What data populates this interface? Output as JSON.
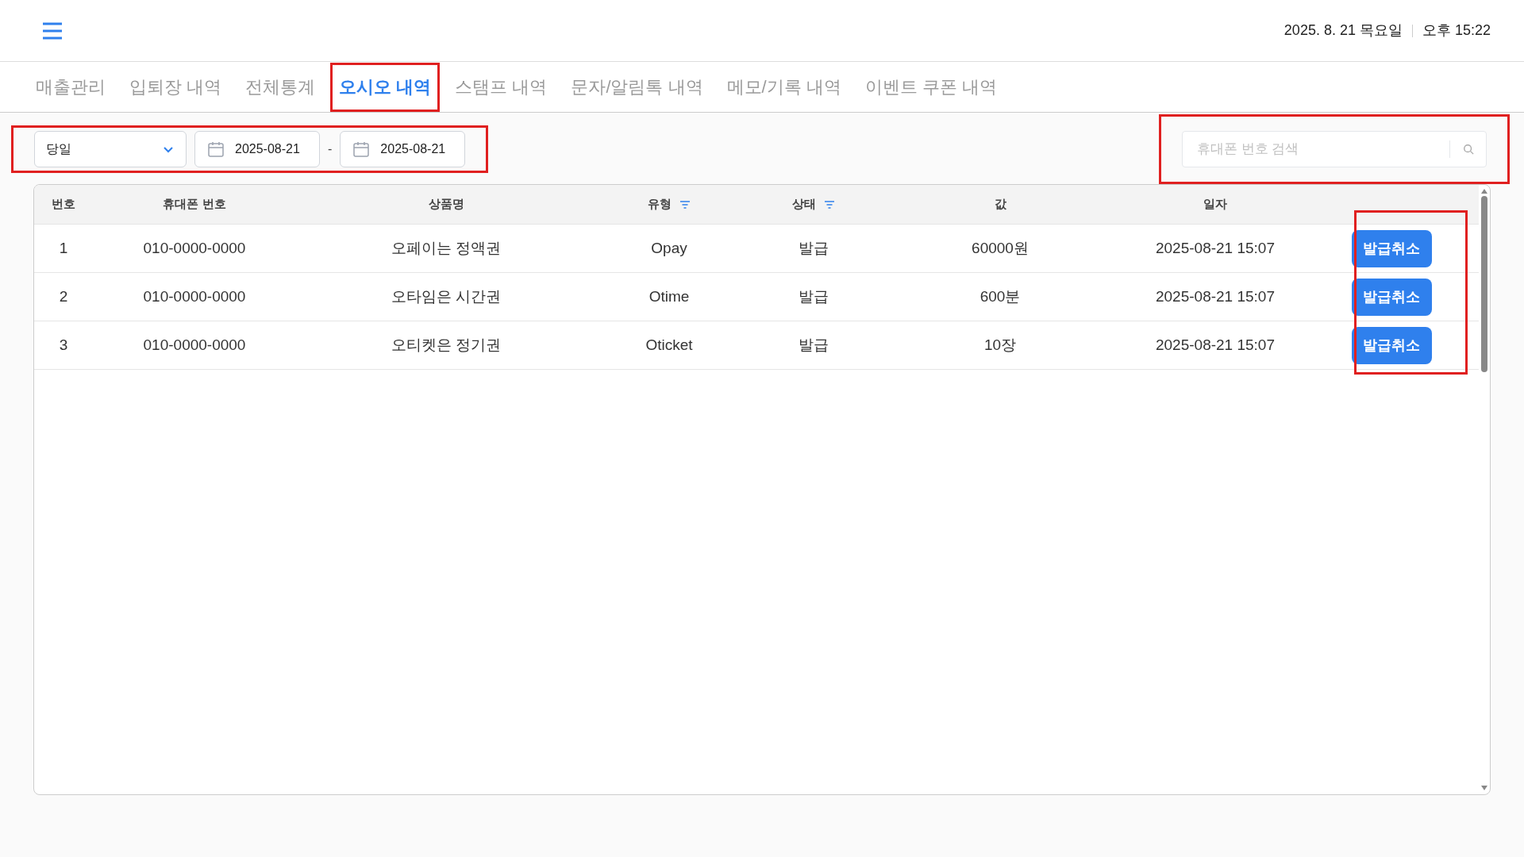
{
  "header": {
    "date": "2025. 8. 21 목요일",
    "time": "오후 15:22"
  },
  "tabs": [
    {
      "label": "매출관리",
      "selected": false,
      "highlighted": false
    },
    {
      "label": "입퇴장 내역",
      "selected": false,
      "highlighted": false
    },
    {
      "label": "전체통계",
      "selected": false,
      "highlighted": false
    },
    {
      "label": "오시오 내역",
      "selected": true,
      "highlighted": true
    },
    {
      "label": "스탬프 내역",
      "selected": false,
      "highlighted": false
    },
    {
      "label": "문자/알림톡 내역",
      "selected": false,
      "highlighted": false
    },
    {
      "label": "메모/기록 내역",
      "selected": false,
      "highlighted": false
    },
    {
      "label": "이벤트 쿠폰 내역",
      "selected": false,
      "highlighted": false
    }
  ],
  "filters": {
    "highlighted": true,
    "period": "당일",
    "start_date": "2025-08-21",
    "separator": "-",
    "end_date": "2025-08-21"
  },
  "search": {
    "highlighted": true,
    "placeholder": "휴대폰 번호 검색"
  },
  "table": {
    "actions_highlighted": true,
    "columns": [
      {
        "label": "번호",
        "filter": false
      },
      {
        "label": "휴대폰 번호",
        "filter": false
      },
      {
        "label": "상품명",
        "filter": false
      },
      {
        "label": "유형",
        "filter": true
      },
      {
        "label": "상태",
        "filter": true
      },
      {
        "label": "값",
        "filter": false
      },
      {
        "label": "일자",
        "filter": false
      }
    ],
    "rows": [
      {
        "cells": [
          "1",
          "010-0000-0000",
          "오페이는 정액권",
          "Opay",
          "발급",
          "60000원",
          "2025-08-21 15:07"
        ],
        "action": "발급취소"
      },
      {
        "cells": [
          "2",
          "010-0000-0000",
          "오타임은 시간권",
          "Otime",
          "발급",
          "600분",
          "2025-08-21 15:07"
        ],
        "action": "발급취소"
      },
      {
        "cells": [
          "3",
          "010-0000-0000",
          "오티켓은 정기권",
          "Oticket",
          "발급",
          "10장",
          "2025-08-21 15:07"
        ],
        "action": "발급취소"
      }
    ]
  }
}
